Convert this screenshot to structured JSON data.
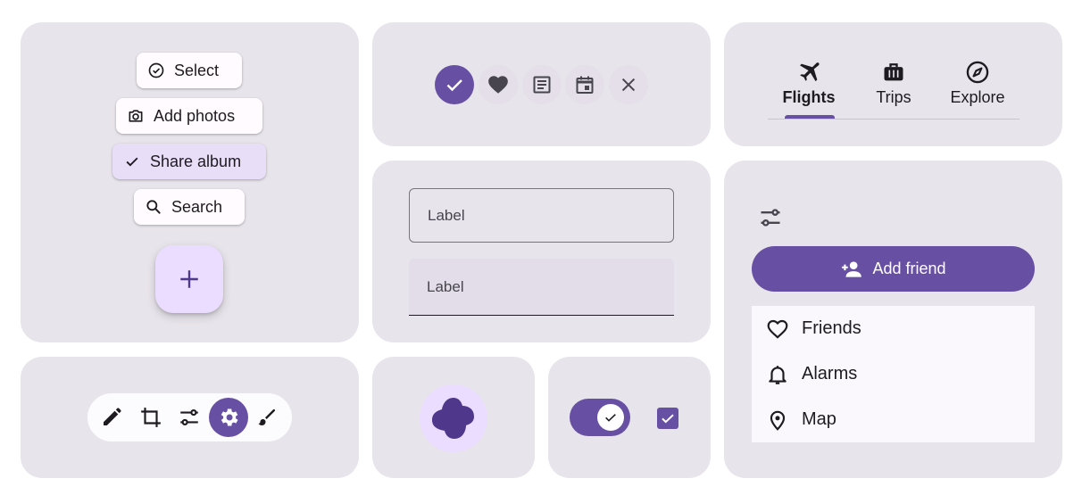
{
  "colors": {
    "primary": "#6750a4",
    "card_bg": "#e8e4eb",
    "selected_chip": "#e8def8",
    "fab_bg": "#eaddff"
  },
  "chips": {
    "select": {
      "label": "Select",
      "icon": "check-circle-icon"
    },
    "add_photos": {
      "label": "Add photos",
      "icon": "camera-icon"
    },
    "share_album": {
      "label": "Share album",
      "icon": "check-icon",
      "selected": true
    },
    "search": {
      "label": "Search",
      "icon": "search-icon"
    }
  },
  "fab": {
    "icon": "plus-icon"
  },
  "icon_buttons": [
    {
      "icon": "check-icon",
      "style": "filled"
    },
    {
      "icon": "heart-icon",
      "style": "tonal"
    },
    {
      "icon": "article-icon",
      "style": "tonal"
    },
    {
      "icon": "calendar-icon",
      "style": "tonal"
    },
    {
      "icon": "close-icon",
      "style": "tonal"
    }
  ],
  "tabs": [
    {
      "label": "Flights",
      "icon": "airplane-icon",
      "active": true
    },
    {
      "label": "Trips",
      "icon": "luggage-icon",
      "active": false
    },
    {
      "label": "Explore",
      "icon": "compass-icon",
      "active": false
    }
  ],
  "text_fields": {
    "outlined": {
      "label": "Label"
    },
    "filled": {
      "label": "Label"
    }
  },
  "side_panel": {
    "filter_icon": "tune-icon",
    "add_friend": {
      "label": "Add friend",
      "icon": "person-add-icon"
    },
    "menu": [
      {
        "label": "Friends",
        "icon": "heart-outline-icon"
      },
      {
        "label": "Alarms",
        "icon": "bell-icon"
      },
      {
        "label": "Map",
        "icon": "location-pin-icon"
      }
    ]
  },
  "toolbar": [
    {
      "icon": "pencil-icon",
      "active": false
    },
    {
      "icon": "crop-icon",
      "active": false
    },
    {
      "icon": "tune-icon",
      "active": false
    },
    {
      "icon": "settings-icon",
      "active": true
    },
    {
      "icon": "brush-icon",
      "active": false
    }
  ],
  "shape": {
    "icon": "blob-shape"
  },
  "toggle": {
    "on": true
  },
  "checkbox": {
    "checked": true
  }
}
